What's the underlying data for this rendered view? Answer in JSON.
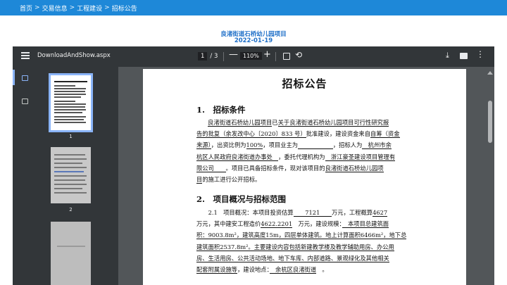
{
  "breadcrumb": {
    "items": [
      "首页",
      "交易信息",
      "工程建设",
      "招标公告"
    ],
    "separator": ">"
  },
  "project": {
    "title": "良渚街道石桥幼儿园项目",
    "date": "2022-01-19"
  },
  "viewer": {
    "filename": "DownloadAndShow.aspx",
    "page_current": "1",
    "page_total": "/ 3",
    "zoom": "110%",
    "minus": "—",
    "plus": "+",
    "thumbnails": [
      {
        "label": "1"
      },
      {
        "label": "2"
      },
      {
        "label": ""
      }
    ]
  },
  "document": {
    "title": "招标公告",
    "section1": {
      "heading": "1.　招标条件",
      "lines": [
        [
          "",
          "良渚街道石桥幼儿园项目",
          "已",
          "关于良渚街道石桥幼儿园项目可行性研究报"
        ],
        [
          "",
          "告的批复（余发改中心〔2020〕833 号）",
          "批准建设，建设资金来自",
          "自筹（资金"
        ],
        [
          "",
          "来源）",
          "，出资比例为",
          "100%",
          "，项目业主为",
          "　　　　　　",
          "，招标人为",
          "　杭州市余"
        ],
        [
          "",
          "杭区人民政府良渚街道办事处　",
          "，委托代理机构为",
          "　浙江豪圣建设项目管理有"
        ],
        [
          "",
          "限公司　　",
          "。项目已具备招标条件，现对该项目的",
          "良渚街道石桥幼儿园项"
        ],
        [
          "",
          "目",
          "的施工进行公开招标。"
        ]
      ]
    },
    "section2": {
      "heading": "2.　项目概况与招标范围",
      "lines": [
        [
          "　　2.1　项目概况：本项目投资估算",
          "　　7121　　",
          "万元，工程概算",
          "4627"
        ],
        [
          "万元，其中建安工程造价",
          "4622.2201",
          "　万元，建设规模：",
          "　本项目总建筑面"
        ],
        [
          "积：9003.8m²，建筑高度15m，四层单体建筑。地上计算面积6466m²，地下总"
        ],
        [
          "建筑面积2537.8m²。主要建设内容包括新建教学楼及教学辅助用房、办公用"
        ],
        [
          "房、生活用房、公共活动场地、地下车库、内部道路、景观绿化及其他相关"
        ],
        [
          "配套附属设施等",
          "，建设地点：",
          "　余杭区良渚街道",
          "　。"
        ]
      ]
    }
  },
  "icons": {
    "menu": "menu-icon",
    "download": "download-icon",
    "print": "print-icon",
    "more": "more-vert-icon",
    "rotate": "rotate-icon",
    "fit": "fit-page-icon",
    "thumbnails": "thumbnails-icon",
    "outline": "outline-icon"
  },
  "colors": {
    "breadcrumb_bg": "#1e88d8",
    "title_blue": "#1e6fc8",
    "toolbar_bg": "#323639",
    "viewer_bg": "#525659",
    "accent": "#8ab4f8"
  }
}
